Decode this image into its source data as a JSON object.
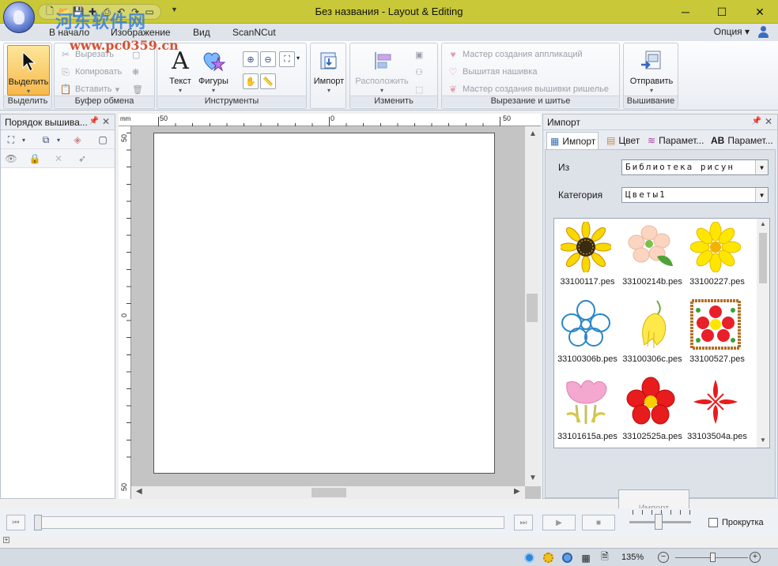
{
  "window": {
    "title": "Без названия - Layout & Editing",
    "minimize": "─",
    "maximize": "☐",
    "close": "✕"
  },
  "watermark": {
    "cn": "河东软件网",
    "url": "www.pc0359.cn"
  },
  "tabs": [
    "В начало",
    "Изображение",
    "Вид",
    "ScanNCut"
  ],
  "options_label": "Опция",
  "ribbon": {
    "select_group": {
      "button": "Выделить",
      "label": "Выделить"
    },
    "clipboard": {
      "cut": "Вырезать",
      "copy": "Копировать",
      "paste": "Вставить",
      "label": "Буфер обмена"
    },
    "tools": {
      "text": "Текст",
      "shapes": "Фигуры",
      "label": "Инструменты"
    },
    "import": {
      "button": "Импорт"
    },
    "change": {
      "arrange": "Расположить",
      "label": "Изменить"
    },
    "cutsew": {
      "applique": "Мастер создания аппликаций",
      "patch": "Вышитая нашивка",
      "cutwork": "Мастер создания вышивки ришелье",
      "label": "Вырезание и шитье"
    },
    "embroidery": {
      "send": "Отправить",
      "label": "Вышивание"
    }
  },
  "left_panel": {
    "title": "Порядок вышива..."
  },
  "ruler": {
    "unit": "mm",
    "top": [
      "50",
      "0",
      "50"
    ],
    "left": [
      "50",
      "0",
      "50"
    ]
  },
  "right_panel": {
    "title": "Импорт",
    "tabs": [
      "Импорт",
      "Цвет",
      "Парамет...",
      "Парамет..."
    ],
    "from_label": "Из",
    "from_value": "Библиотека рисун",
    "category_label": "Категория",
    "category_value": "Цветы1",
    "files": [
      "33100117.pes",
      "33100214b.pes",
      "33100227.pes",
      "33100306b.pes",
      "33100306c.pes",
      "33100527.pes",
      "33101615a.pes",
      "33102525a.pes",
      "33103504a.pes"
    ],
    "import_button": "Импорт"
  },
  "playback": {
    "scroll_label": "Прокрутка"
  },
  "status": {
    "zoom": "135%"
  }
}
